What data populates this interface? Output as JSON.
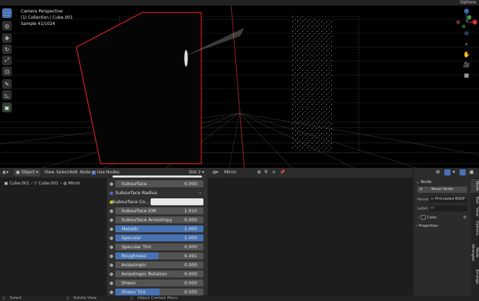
{
  "topbar": {
    "options_label": "Options"
  },
  "viewport": {
    "info": {
      "line1": "Camera Perspective",
      "line2": "(1) Collection | Cube.001",
      "line3": "Sample 41/1024"
    },
    "gizmo": {
      "x_color": "#c8303a",
      "y_color": "#4a9a3a",
      "z_color": "#3a6ab8"
    }
  },
  "tools": [
    "select-box-icon",
    "cursor-icon",
    "move-icon",
    "rotate-icon",
    "scale-icon",
    "transform-icon",
    "annotate-icon",
    "measure-icon",
    "add-cube-icon"
  ],
  "node_header": {
    "object_mode": "Object",
    "menu": {
      "view": "View",
      "select": "Select",
      "add": "Add",
      "node": "Node"
    },
    "use_nodes": "Use Nodes",
    "slot": "Slot 2",
    "material": "Mirror"
  },
  "breadcrumb": {
    "object": "Cube.001",
    "mesh": "Cube.001",
    "material": "Mirror"
  },
  "node": {
    "rows": [
      {
        "label": "Subsurface",
        "value": "0.000",
        "style": "gray"
      },
      {
        "label": "Subsurface Radius",
        "value": "",
        "style": "dropdown"
      },
      {
        "label": "Subsurface Co...",
        "value": "",
        "style": "color"
      },
      {
        "label": "Subsurface IOR",
        "value": "1.010",
        "style": "gray"
      },
      {
        "label": "Subsurface Anisotropy",
        "value": "0.000",
        "style": "gray"
      },
      {
        "label": "Metallic",
        "value": "1.000",
        "style": "full"
      },
      {
        "label": "Specular",
        "value": "1.000",
        "style": "full"
      },
      {
        "label": "Specular Tint",
        "value": "0.000",
        "style": "gray"
      },
      {
        "label": "Roughness",
        "value": "0.491",
        "style": "partial",
        "fraction": 0.491
      },
      {
        "label": "Anisotropic",
        "value": "0.000",
        "style": "gray"
      },
      {
        "label": "Anisotropic Rotation",
        "value": "0.000",
        "style": "gray"
      },
      {
        "label": "Sheen",
        "value": "0.000",
        "style": "gray"
      },
      {
        "label": "Sheen Tint",
        "value": "0.500",
        "style": "partial",
        "fraction": 0.5
      }
    ]
  },
  "sidebar": {
    "panel_title": "Node",
    "reset_label": "Reset Node",
    "name_label": "Name:",
    "name_value": "Principled BSDF",
    "label_label": "Label:",
    "color_label": "Color",
    "properties_label": "Properties"
  },
  "vtabs": [
    "Node",
    "Tool",
    "View",
    "Options",
    "Node Wrangler",
    "Arrange"
  ],
  "statusbar": {
    "select": "Select",
    "rotate": "Rotate View",
    "context": "Object Context Menu"
  }
}
